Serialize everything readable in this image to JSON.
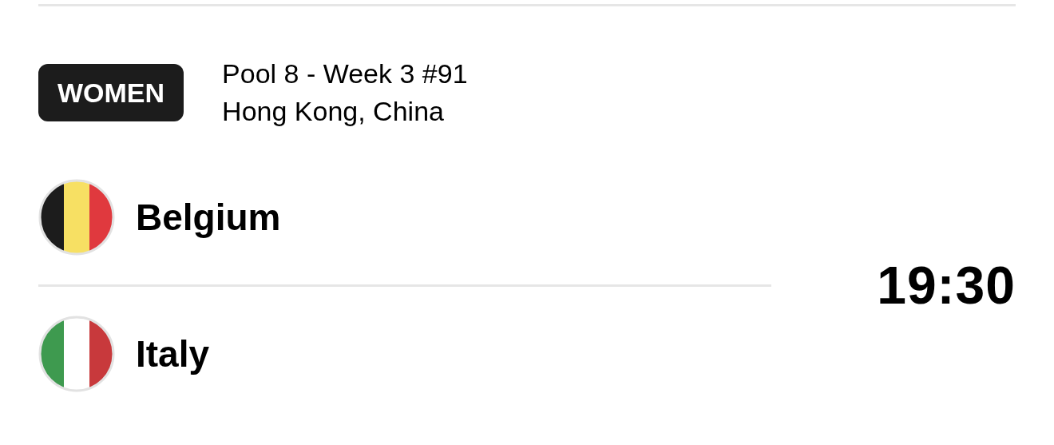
{
  "match": {
    "category": "WOMEN",
    "pool": "Pool 8 - Week 3 #91",
    "venue": "Hong Kong, China",
    "time": "19:30"
  },
  "teams": [
    {
      "name": "Belgium",
      "kind": "belgian"
    },
    {
      "name": "Italy",
      "kind": "italian"
    }
  ]
}
